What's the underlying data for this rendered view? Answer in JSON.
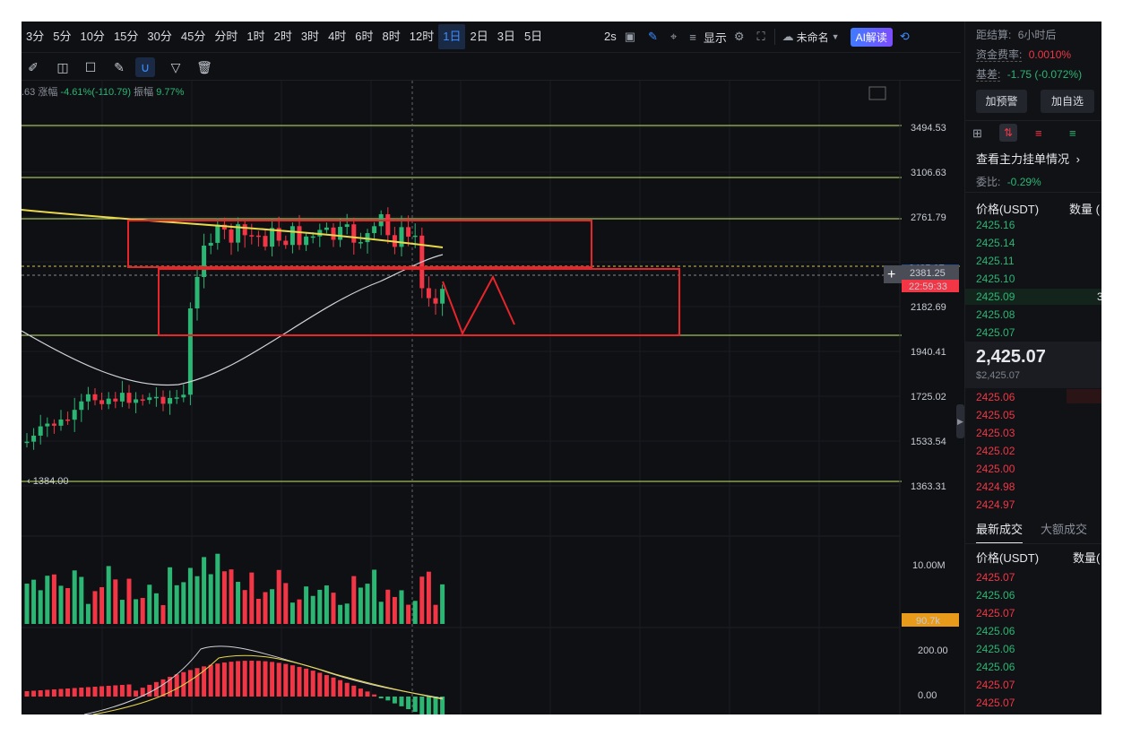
{
  "toolbar": {
    "timeframes": [
      "3分",
      "5分",
      "10分",
      "15分",
      "30分",
      "45分",
      "分时",
      "1时",
      "2时",
      "3时",
      "4时",
      "6时",
      "8时",
      "12时",
      "1日",
      "2日",
      "3日",
      "5日"
    ],
    "active_timeframe": "1日",
    "interval_label": "2s",
    "display_label": "显示",
    "layout_name": "未命名",
    "ai_label": "AI解读"
  },
  "info_line": {
    "prefix": ".63",
    "change_label": "涨幅",
    "change_value": "-4.61%(-110.79)",
    "amplitude_label": "振幅",
    "amplitude_value": "9.77%"
  },
  "price_axis": {
    "ticks": [
      "3494.53",
      "3106.63",
      "2761.79",
      "2182.69",
      "1940.41",
      "1725.02",
      "1533.54",
      "1363.31"
    ],
    "current_price": "2381.25",
    "countdown": "22:59:33",
    "last_label_partial": "2425.07",
    "low_marker": "1384.00"
  },
  "volume_axis": {
    "ticks": [
      "10.00M"
    ],
    "current": "90.7k"
  },
  "macd_axis": {
    "ticks": [
      "200.00",
      "0.00"
    ]
  },
  "sidebar": {
    "settlement_label": "距结算:",
    "settlement_value": "6小时后",
    "funding_label": "资金费率:",
    "funding_value": "0.0010%",
    "basis_label": "基差:",
    "basis_value": "-1.75 (-0.072%)",
    "alert_button": "加预警",
    "watchlist_button": "加自选",
    "orderbook_link": "查看主力挂单情况",
    "ratio_label": "委比:",
    "ratio_value": "-0.29%",
    "price_header": "价格(USDT)",
    "qty_header": "数量 (",
    "bids_top": [
      "2425.16",
      "2425.14",
      "2425.11",
      "2425.10",
      "2425.09",
      "2425.08",
      "2425.07"
    ],
    "highlight_qty": "3",
    "last_price": "2,425.07",
    "last_price_usd": "$2,425.07",
    "asks": [
      "2425.06",
      "2425.05",
      "2425.03",
      "2425.02",
      "2425.00",
      "2424.98",
      "2424.97"
    ],
    "trades_tab_active": "最新成交",
    "trades_tab_other": "大额成交",
    "trades_price_header": "价格(USDT)",
    "trades_qty_header": "数量(",
    "trades": [
      {
        "price": "2425.07",
        "side": "sell"
      },
      {
        "price": "2425.06",
        "side": "buy"
      },
      {
        "price": "2425.07",
        "side": "sell"
      },
      {
        "price": "2425.06",
        "side": "buy"
      },
      {
        "price": "2425.06",
        "side": "buy"
      },
      {
        "price": "2425.06",
        "side": "buy"
      },
      {
        "price": "2425.07",
        "side": "sell"
      },
      {
        "price": "2425.07",
        "side": "sell"
      }
    ]
  },
  "colors": {
    "up": "#2bb673",
    "down": "#f23645",
    "ma_yellow": "#e8d84a",
    "ma_white": "#cfd2d8",
    "box": "#e8252b",
    "hline": "#c6e86a"
  }
}
